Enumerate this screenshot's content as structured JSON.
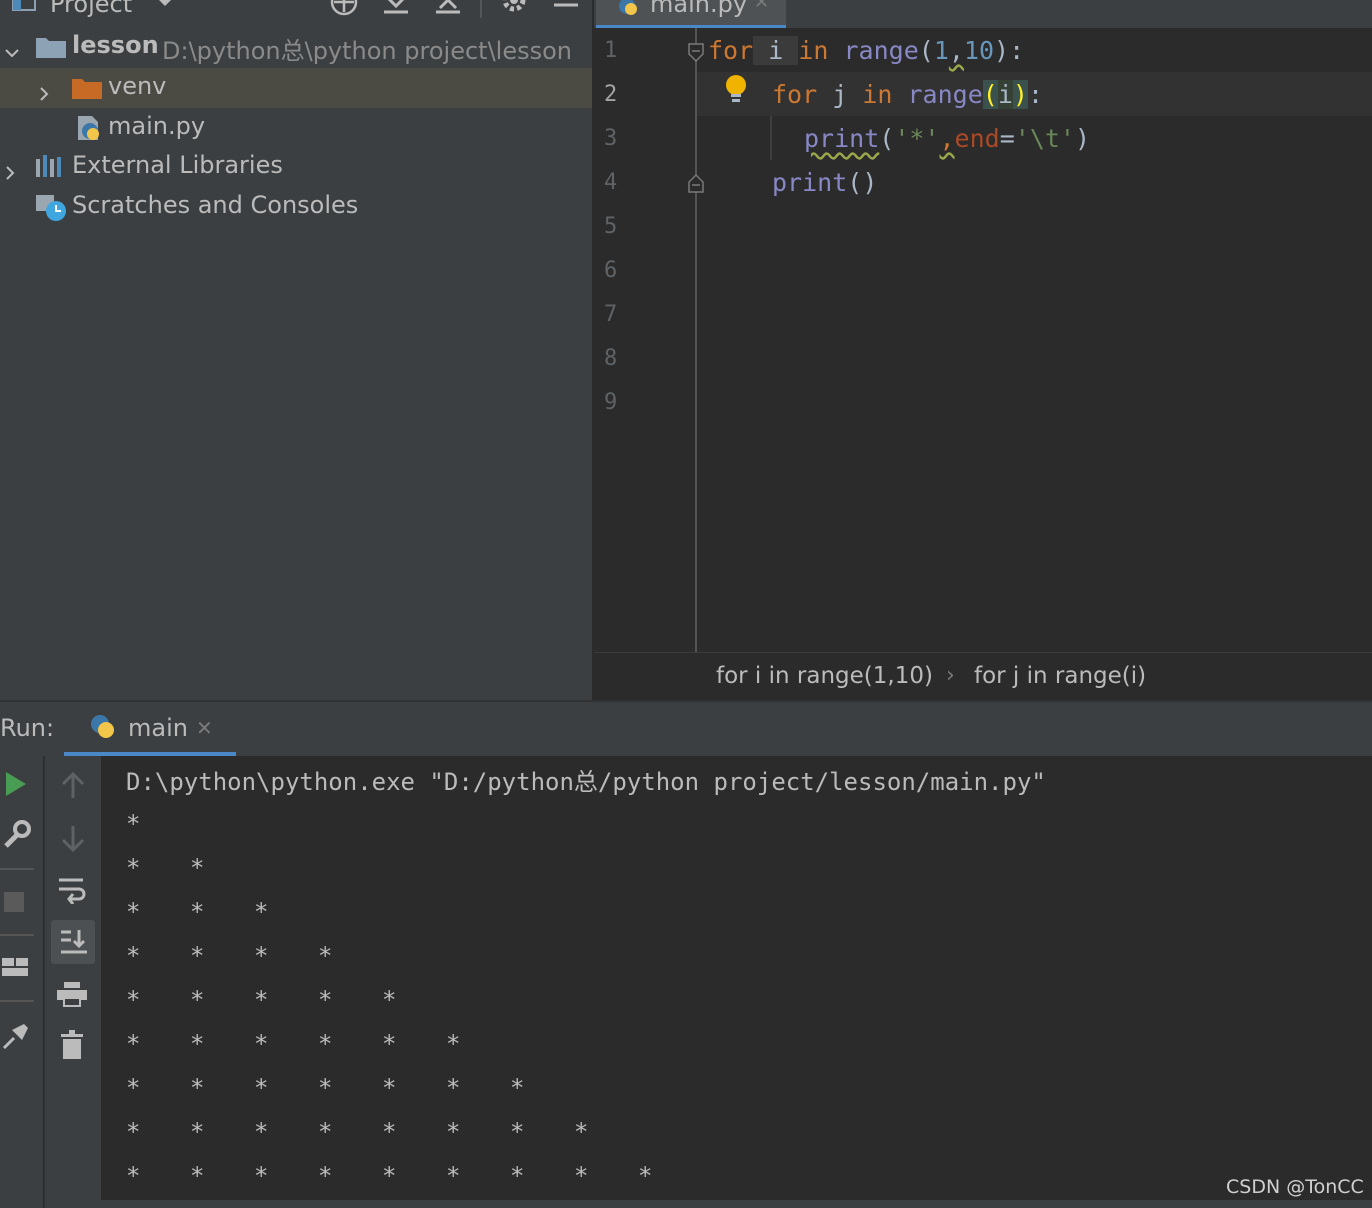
{
  "project_pane": {
    "title": "Project",
    "tree": [
      {
        "label": "lesson",
        "path": "D:\\python总\\python project\\lesson"
      },
      {
        "label": "venv"
      },
      {
        "label": "main.py"
      },
      {
        "label": "External Libraries"
      },
      {
        "label": "Scratches and Consoles"
      }
    ]
  },
  "editor": {
    "tab_label": "main.py",
    "line_numbers": [
      "1",
      "2",
      "3",
      "4",
      "5",
      "6",
      "7",
      "8",
      "9"
    ],
    "current_line": "2",
    "code": {
      "line1": {
        "kw1": "for",
        "v1": " i ",
        "kw2": "in",
        "sp": " ",
        "fn": "range",
        "p1": "(",
        "n1": "1",
        "c": ",",
        "n2": "10",
        "p2": "):"
      },
      "line2": {
        "kw1": "for",
        "v1": " j ",
        "kw2": "in",
        "sp": " ",
        "fn": "range",
        "p1": "(",
        "v2": "i",
        "p2": ")",
        ":": ":"
      },
      "line3": {
        "fn": "print",
        "p1": "(",
        "s1": "'*'",
        "c": ",",
        "param": "end",
        "eq": "=",
        "s2": "'\\t'",
        "p2": ")"
      },
      "line4": {
        "fn": "print",
        "p": "()"
      }
    },
    "breadcrumbs": [
      "for i in range(1,10)",
      "for j in range(i)"
    ],
    "breadcrumb_sep": "›"
  },
  "run": {
    "label": "Run:",
    "tab_label": "main",
    "command": "D:\\python\\python.exe \"D:/python总/python project/lesson/main.py\"",
    "output_rows": [
      1,
      2,
      3,
      4,
      5,
      6,
      7,
      8,
      9
    ],
    "output_char": "*"
  },
  "watermark": "CSDN @TonCC",
  "colors": {
    "keyword": "#cc7832",
    "builtin": "#8888c6",
    "number": "#6897bb",
    "string": "#6a8759",
    "run_green": "#499c54",
    "tab_underline": "#4a88c7"
  }
}
